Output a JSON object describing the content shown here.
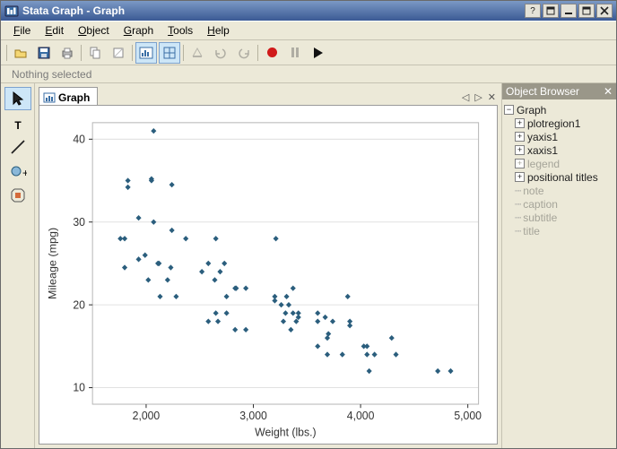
{
  "window": {
    "title": "Stata Graph - Graph"
  },
  "menu": {
    "file": "File",
    "edit": "Edit",
    "object": "Object",
    "graph": "Graph",
    "tools": "Tools",
    "help": "Help"
  },
  "status": {
    "message": "Nothing selected"
  },
  "tab": {
    "label": "Graph"
  },
  "browser": {
    "title": "Object Browser",
    "root": "Graph",
    "items": [
      "plotregion1",
      "yaxis1",
      "xaxis1",
      "legend",
      "positional titles",
      "note",
      "caption",
      "subtitle",
      "title"
    ]
  },
  "chart_data": {
    "type": "scatter",
    "xlabel": "Weight (lbs.)",
    "ylabel": "Mileage (mpg)",
    "xlim": [
      1500,
      5100
    ],
    "ylim": [
      8,
      42
    ],
    "xticks": [
      2000,
      3000,
      4000,
      5000
    ],
    "yticks": [
      10,
      20,
      30,
      40
    ],
    "xticklabels": [
      "2,000",
      "3,000",
      "4,000",
      "5,000"
    ],
    "yticklabels": [
      "10",
      "20",
      "30",
      "40"
    ],
    "points": [
      [
        1760,
        28
      ],
      [
        1800,
        28
      ],
      [
        1800,
        24.5
      ],
      [
        1830,
        35
      ],
      [
        1830,
        34.2
      ],
      [
        1930,
        25.5
      ],
      [
        1930,
        30.5
      ],
      [
        1990,
        26
      ],
      [
        2020,
        23
      ],
      [
        2050,
        35
      ],
      [
        2050,
        35.2
      ],
      [
        2070,
        41
      ],
      [
        2070,
        30
      ],
      [
        2110,
        25
      ],
      [
        2120,
        25
      ],
      [
        2130,
        21
      ],
      [
        2200,
        23
      ],
      [
        2230,
        24.5
      ],
      [
        2240,
        29
      ],
      [
        2240,
        34.5
      ],
      [
        2280,
        21
      ],
      [
        2370,
        28
      ],
      [
        2520,
        24
      ],
      [
        2580,
        25
      ],
      [
        2580,
        18
      ],
      [
        2640,
        23
      ],
      [
        2650,
        28
      ],
      [
        2650,
        19
      ],
      [
        2670,
        18
      ],
      [
        2690,
        24
      ],
      [
        2730,
        25
      ],
      [
        2750,
        21
      ],
      [
        2750,
        19
      ],
      [
        2830,
        17
      ],
      [
        2830,
        22
      ],
      [
        2840,
        22
      ],
      [
        2930,
        22
      ],
      [
        2930,
        17
      ],
      [
        3200,
        20.5
      ],
      [
        3200,
        21
      ],
      [
        3210,
        28
      ],
      [
        3260,
        20
      ],
      [
        3280,
        18
      ],
      [
        3300,
        19
      ],
      [
        3310,
        21
      ],
      [
        3330,
        20
      ],
      [
        3350,
        17
      ],
      [
        3370,
        19
      ],
      [
        3370,
        22
      ],
      [
        3400,
        18
      ],
      [
        3420,
        19
      ],
      [
        3420,
        18.5
      ],
      [
        3600,
        19
      ],
      [
        3600,
        18
      ],
      [
        3600,
        15
      ],
      [
        3670,
        18.5
      ],
      [
        3690,
        16
      ],
      [
        3690,
        14
      ],
      [
        3700,
        16.5
      ],
      [
        3740,
        18
      ],
      [
        3830,
        14
      ],
      [
        3880,
        21
      ],
      [
        3900,
        17.5
      ],
      [
        3900,
        18
      ],
      [
        4030,
        15
      ],
      [
        4060,
        14
      ],
      [
        4060,
        15
      ],
      [
        4080,
        12
      ],
      [
        4130,
        14
      ],
      [
        4290,
        16
      ],
      [
        4330,
        14
      ],
      [
        4720,
        12
      ],
      [
        4840,
        12
      ]
    ]
  }
}
